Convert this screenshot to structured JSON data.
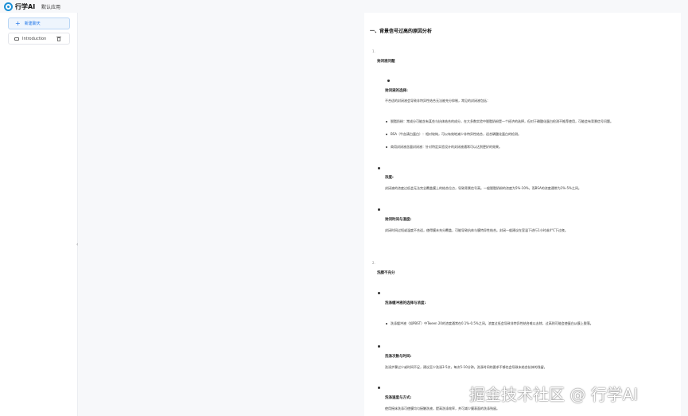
{
  "header": {
    "brand": "行学AI",
    "app_tab": "默认应用"
  },
  "sidebar": {
    "new_chat_label": "新建聊天",
    "conversations": [
      {
        "label": "Introduction"
      }
    ]
  },
  "document": {
    "section_title": "一、背景信号过高的原因分析",
    "blocks": [
      {
        "num": "1.",
        "heading": "封闭液问题"
      },
      {
        "heading": "封闭液的选择:"
      },
      {
        "text": "不合适的封闭液会导致非特异性结合无法被充分抑制，常见的封闭液包括："
      },
      {
        "text": "脱脂奶粉：常成分可能含有某些与抗体结合的成分，在大多数实验中脱脂奶粉是一个经济的选择，但对于磷酸化蛋白检测不推荐使用，可能会有背景信号问题。"
      },
      {
        "text": "BSA（牛血清白蛋白）：相对较纯，可以有效地减少非特异性结合，适合磷酸化蛋白的检测。"
      },
      {
        "text": "商用封闭液含量封闭液：针对特定实验设计的封闭液通常可以达到更好的效果。"
      },
      {
        "heading": "浓度:"
      },
      {
        "text": "封闭液的浓度过低会无法完全覆盖膜上的结合位点，导致背景信号高。一般脱脂奶粉的浓度为5%-10%，而BSA的浓度通常为1%-5%之间。"
      },
      {
        "heading": "封闭时间与温度:"
      },
      {
        "text": "封闭时间过短或温度不合适，使得膜未充分覆盖，可能导致抗体与膜特异性结合。封闭一般建议在室温下进行1小时或4°C下过夜。"
      },
      {
        "num": "2.",
        "heading": "洗膜不充分"
      },
      {
        "heading": "洗涤缓冲液的选择与浓度:"
      },
      {
        "text": "洗涤缓冲液（如PBST）中Tween 20的浓度通常在0.1%-0.5%之间。浓度过低会导致非特异性结合难以去除，过高则可能会使蛋白从膜上脱落。"
      },
      {
        "heading": "洗涤次数与时间:"
      },
      {
        "text": "洗涤步骤过少或时间不足，建议至少洗涤3-5次，每次5-10分钟。洗涤时间的要求不够也会导致未结合抗体的残留。"
      },
      {
        "heading": "洗涤速度与方式:"
      },
      {
        "text": "使用摇床洗涤可使膜均匀接触洗液，提高洗涤效率，并可减少膜表面的洗涤残留。"
      }
    ]
  },
  "watermark": "掘金技术社区 @ 行学AI"
}
